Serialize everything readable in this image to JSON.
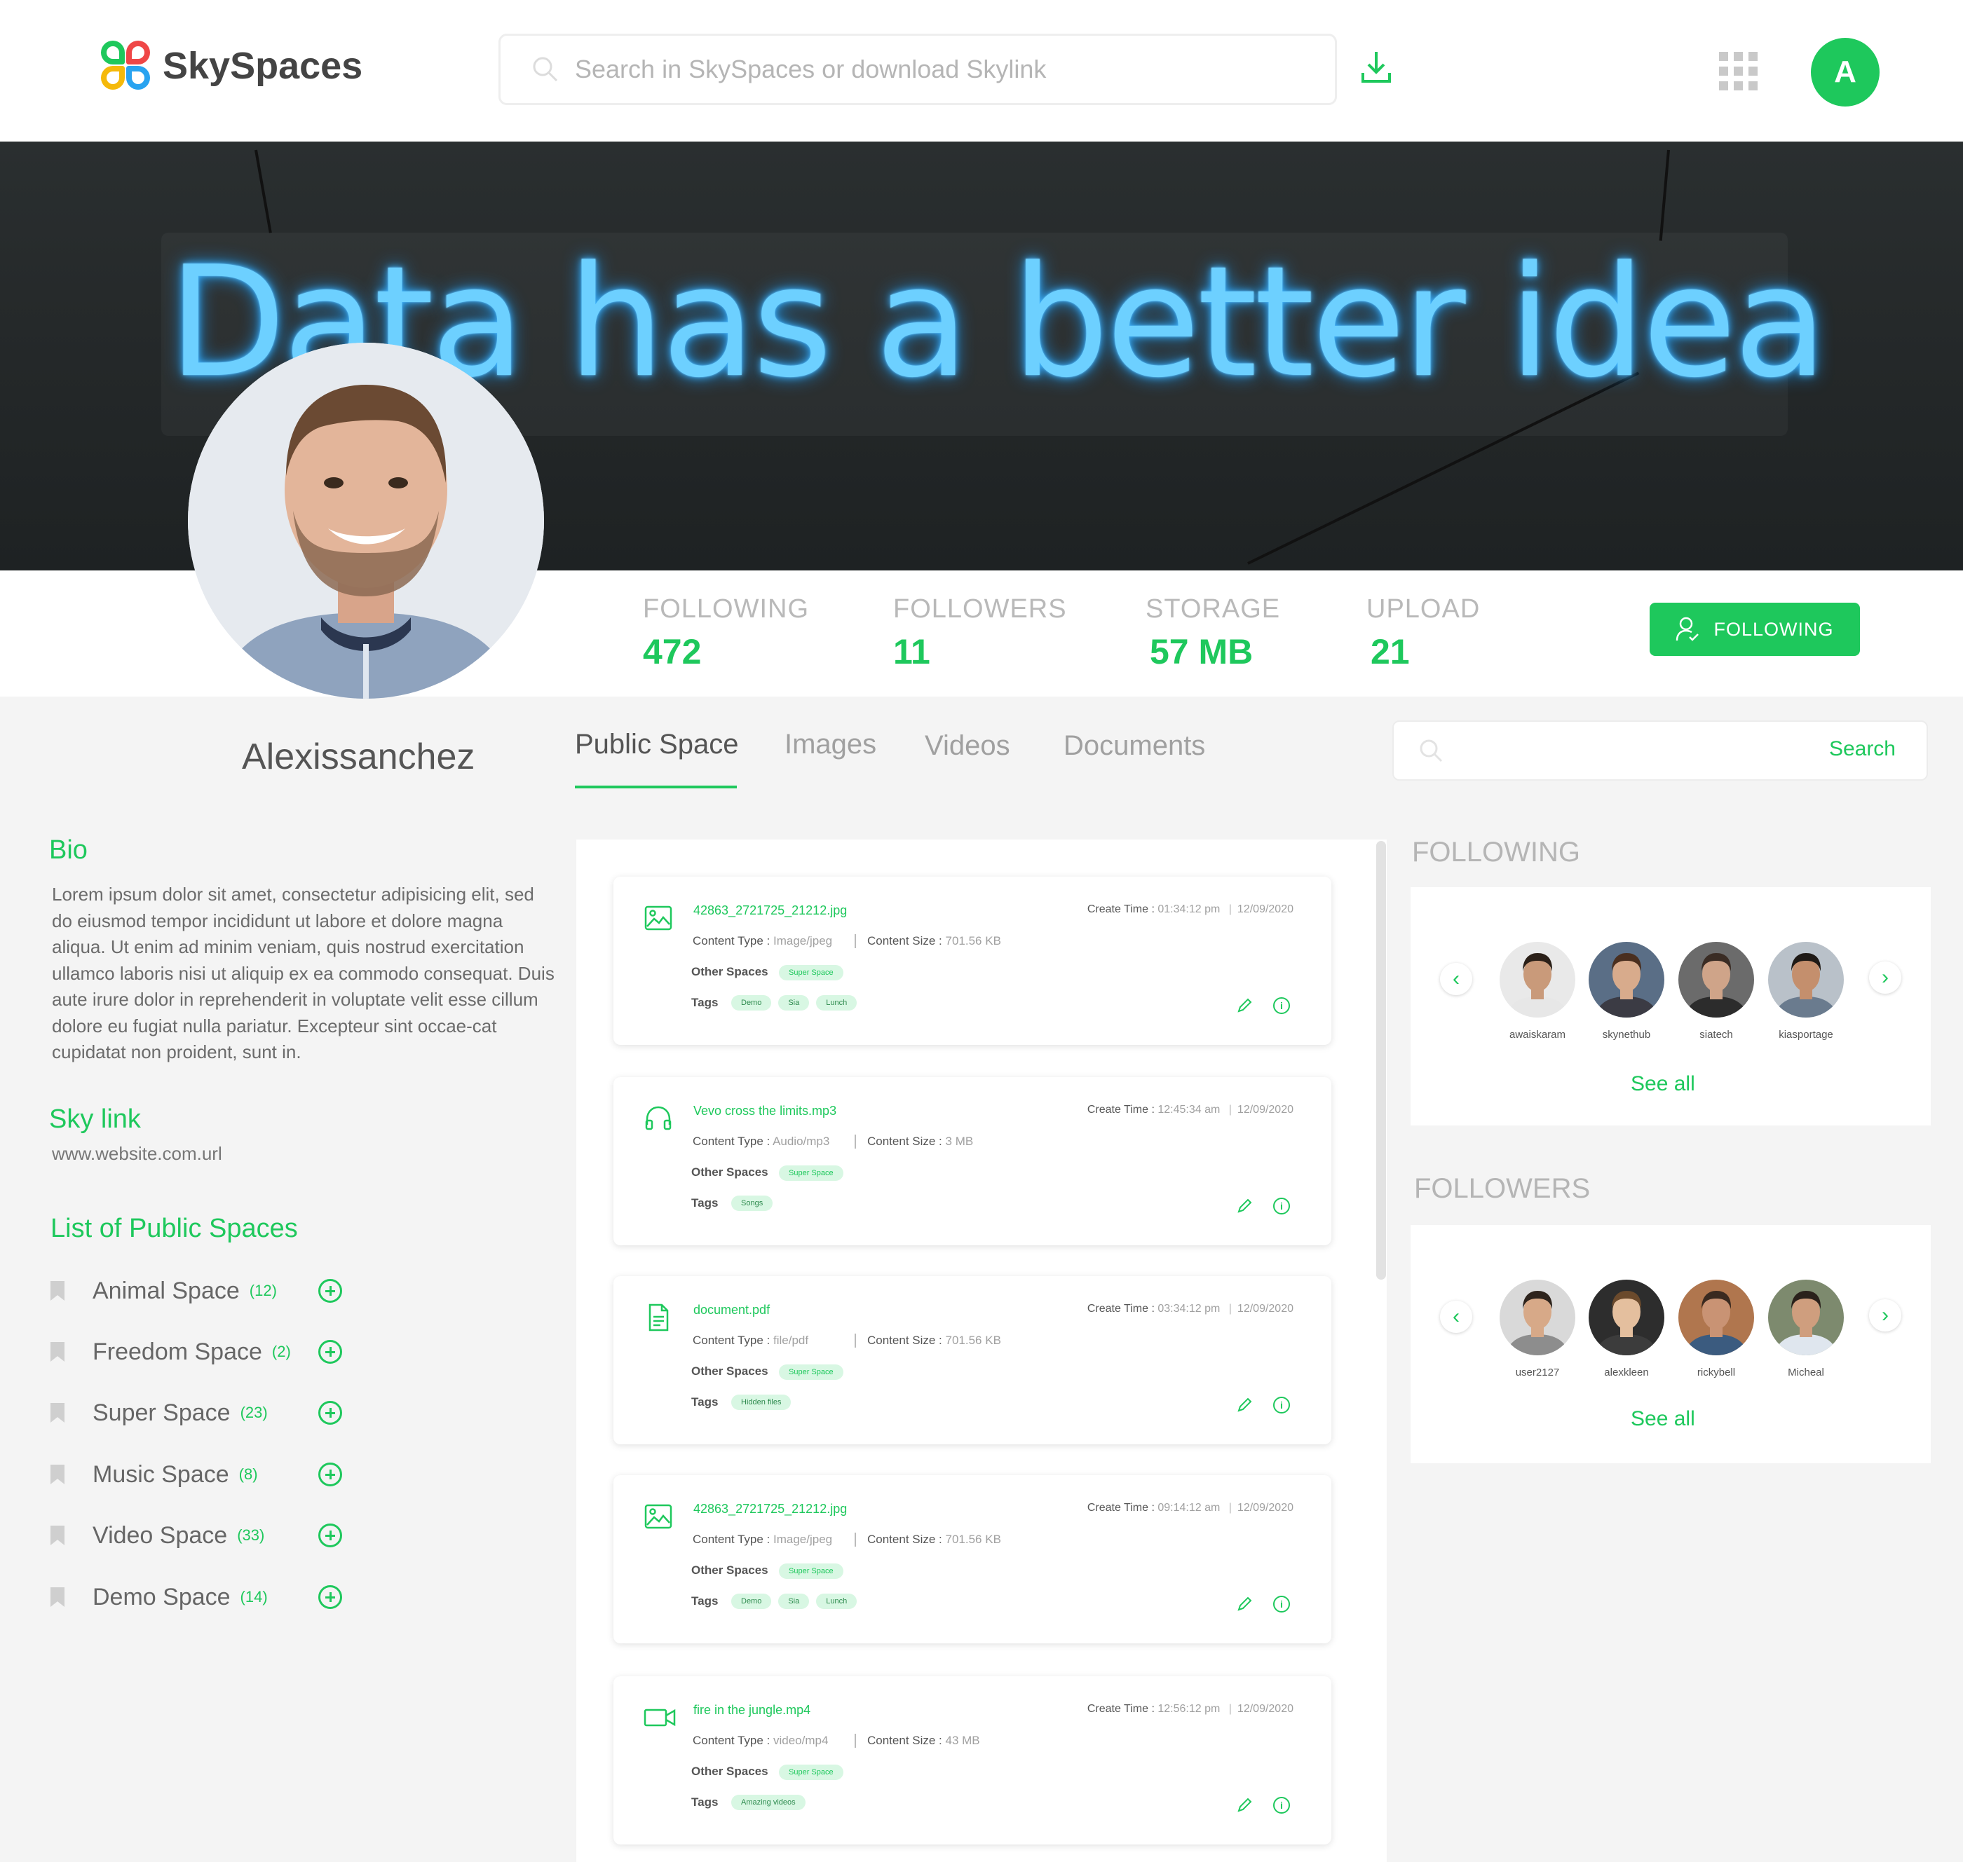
{
  "header": {
    "brand": "SkySpaces",
    "search_placeholder": "Search in SkySpaces or download Skylink",
    "user_initial": "A"
  },
  "banner": {
    "neon_text": "Data has a better idea"
  },
  "stats": [
    {
      "label": "FOLLOWING",
      "value": "472"
    },
    {
      "label": "FOLLOWERS",
      "value": "11"
    },
    {
      "label": "STORAGE",
      "value": "57 MB"
    },
    {
      "label": "UPLOAD",
      "value": "21"
    }
  ],
  "follow_button": "FOLLOWING",
  "profile": {
    "username": "Alexissanchez"
  },
  "tabs": [
    {
      "label": "Public Space",
      "active": true
    },
    {
      "label": "Images",
      "active": false
    },
    {
      "label": "Videos",
      "active": false
    },
    {
      "label": "Documents",
      "active": false
    }
  ],
  "side_search": {
    "button": "Search"
  },
  "left": {
    "bio_title": "Bio",
    "bio_text": "Lorem ipsum dolor sit amet, consectetur adipisicing elit, sed do eiusmod tempor incididunt ut labore et dolore magna aliqua. Ut enim ad minim veniam, quis nostrud exercitation ullamco laboris nisi ut aliquip ex ea commodo consequat. Duis aute irure dolor in reprehenderit in voluptate velit esse cillum dolore eu fugiat nulla pariatur. Excepteur sint occae-cat cupidatat non proident, sunt in.",
    "skylink_title": "Sky link",
    "skylink_url": "www.website.com.url",
    "spaces_title": "List of Public Spaces",
    "spaces": [
      {
        "name": "Animal Space",
        "count": "(12)"
      },
      {
        "name": "Freedom Space",
        "count": "(2)"
      },
      {
        "name": "Super Space",
        "count": "(23)"
      },
      {
        "name": "Music Space",
        "count": "(8)"
      },
      {
        "name": "Video Space",
        "count": "(33)"
      },
      {
        "name": "Demo Space",
        "count": "(14)"
      }
    ]
  },
  "labels": {
    "create_time": "Create Time :",
    "content_type": "Content Type :",
    "content_size": "Content Size :",
    "other_spaces": "Other Spaces",
    "tags": "Tags"
  },
  "cards": [
    {
      "icon": "image-icon",
      "file": "42863_2721725_21212.jpg",
      "time": "01:34:12 pm",
      "date": "12/09/2020",
      "type": "Image/jpeg",
      "size": "701.56 KB",
      "spaces": [
        "Super Space"
      ],
      "tags": [
        "Demo",
        "Sia",
        "Lunch"
      ]
    },
    {
      "icon": "headphones-icon",
      "file": "Vevo cross the limits.mp3",
      "time": "12:45:34 am",
      "date": "12/09/2020",
      "type": "Audio/mp3",
      "size": "3 MB",
      "spaces": [
        "Super Space"
      ],
      "tags": [
        "Songs"
      ]
    },
    {
      "icon": "document-icon",
      "file": "document.pdf",
      "time": "03:34:12 pm",
      "date": "12/09/2020",
      "type": "file/pdf",
      "size": "701.56 KB",
      "spaces": [
        "Super Space"
      ],
      "tags": [
        "Hidden files"
      ]
    },
    {
      "icon": "image-icon",
      "file": "42863_2721725_21212.jpg",
      "time": "09:14:12 am",
      "date": "12/09/2020",
      "type": "Image/jpeg",
      "size": "701.56 KB",
      "spaces": [
        "Super Space"
      ],
      "tags": [
        "Demo",
        "Sia",
        "Lunch"
      ]
    },
    {
      "icon": "video-icon",
      "file": "fire in the jungle.mp4",
      "time": "12:56:12 pm",
      "date": "12/09/2020",
      "type": "video/mp4",
      "size": "43 MB",
      "spaces": [
        "Super Space"
      ],
      "tags": [
        "Amazing videos"
      ]
    }
  ],
  "right": {
    "following_title": "FOLLOWING",
    "following": [
      {
        "name": "awaiskaram",
        "skin": "#c99a7a",
        "hair": "#2b2018",
        "shirt": "#e7e7e7",
        "bg": "#e9e9e9"
      },
      {
        "name": "skynethub",
        "skin": "#d8ab8c",
        "hair": "#4a2f1f",
        "shirt": "#3b3b44",
        "bg": "#5a6e86"
      },
      {
        "name": "siatech",
        "skin": "#cfa489",
        "hair": "#3a2c24",
        "shirt": "#2c2c2c",
        "bg": "#6b6b6b"
      },
      {
        "name": "kiasportage",
        "skin": "#c48f6d",
        "hair": "#1f1a16",
        "shirt": "#6a7b8e",
        "bg": "#b9c1c9"
      }
    ],
    "followers_title": "FOLLOWERS",
    "followers": [
      {
        "name": "user2127",
        "skin": "#d7a988",
        "hair": "#2e241d",
        "shirt": "#8d8d8d",
        "bg": "#d9d9d9"
      },
      {
        "name": "alexkleen",
        "skin": "#e4bf9e",
        "hair": "#6b4a2c",
        "shirt": "#3c3c3c",
        "bg": "#2d2d2d"
      },
      {
        "name": "rickybell",
        "skin": "#c99374",
        "hair": "#3a2a20",
        "shirt": "#3b5b7f",
        "bg": "#b0764e"
      },
      {
        "name": "Micheal",
        "skin": "#cf9e7e",
        "hair": "#2a211b",
        "shirt": "#dfe6ee",
        "bg": "#7d8a6e"
      }
    ],
    "see_all": "See all"
  },
  "colors": {
    "accent": "#1ec85c",
    "tag_bg": "#d8f7e3"
  }
}
